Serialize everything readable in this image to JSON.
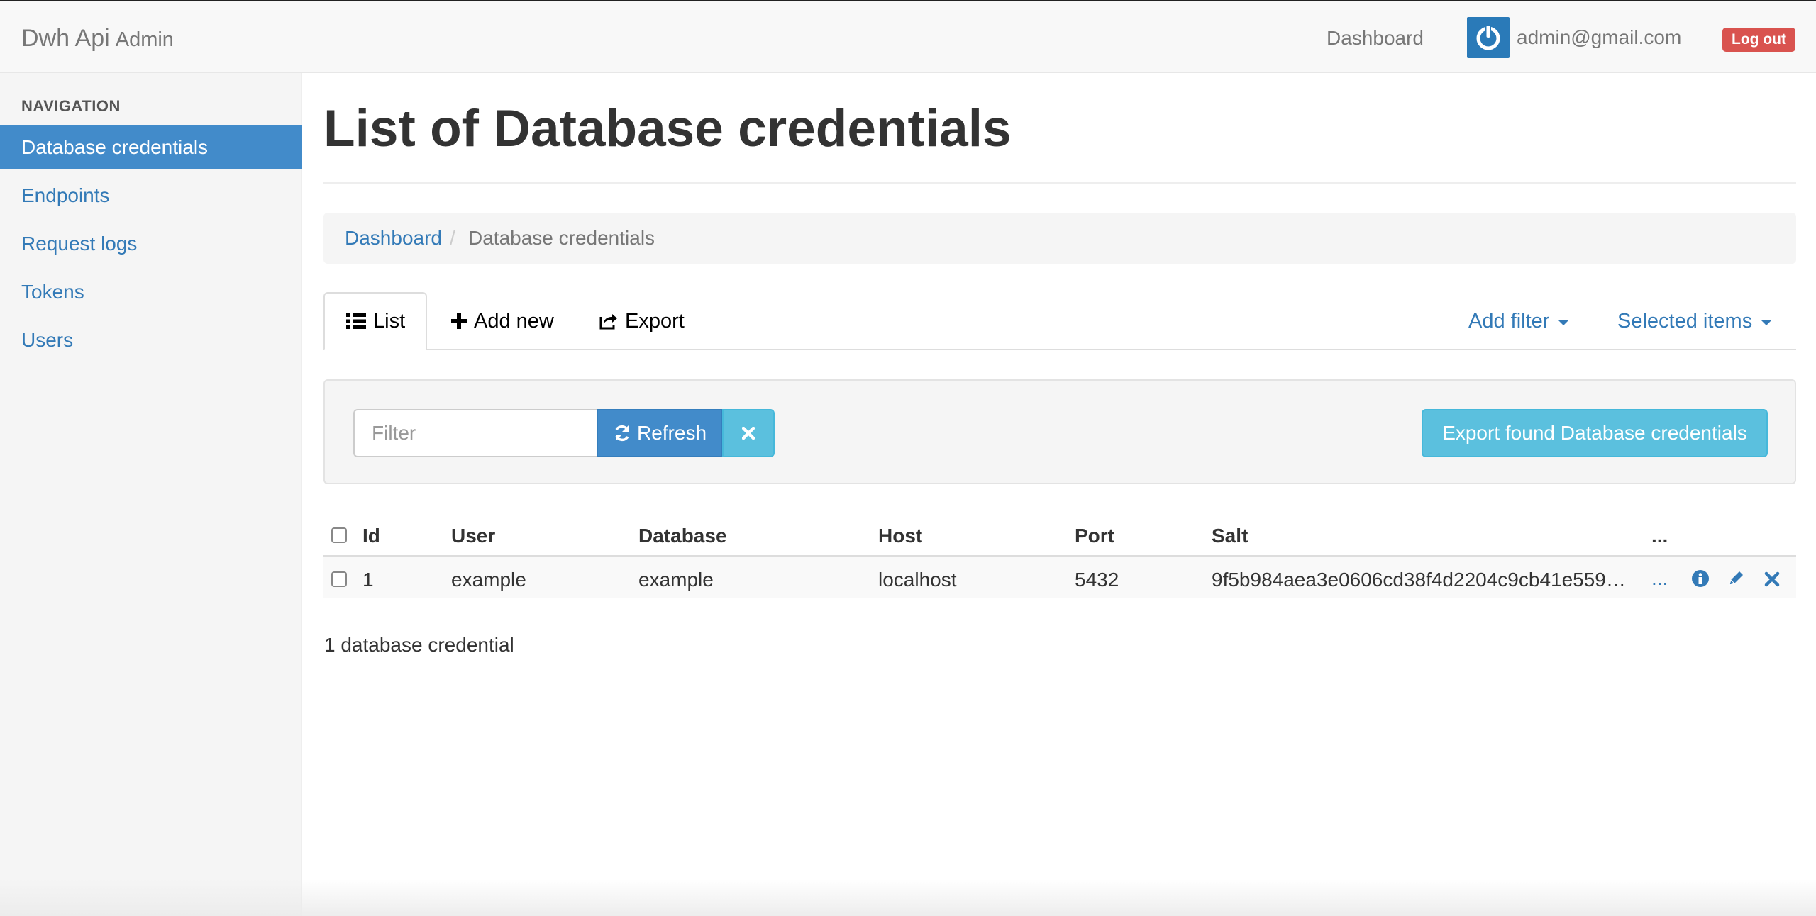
{
  "navbar": {
    "brand_main": "Dwh Api",
    "brand_sub": "Admin",
    "dashboard_link": "Dashboard",
    "user_email": "admin@gmail.com",
    "logout_label": "Log out",
    "avatar_icon": "power-icon",
    "avatar_color": "#2a7ab8"
  },
  "sidebar": {
    "header": "NAVIGATION",
    "items": [
      {
        "label": "Database credentials",
        "active": true
      },
      {
        "label": "Endpoints",
        "active": false
      },
      {
        "label": "Request logs",
        "active": false
      },
      {
        "label": "Tokens",
        "active": false
      },
      {
        "label": "Users",
        "active": false
      }
    ]
  },
  "page": {
    "title": "List of Database credentials"
  },
  "breadcrumb": {
    "link": "Dashboard",
    "separator": "/",
    "current": "Database credentials"
  },
  "tabs": {
    "list": "List",
    "add_new": "Add new",
    "export": "Export",
    "add_filter": "Add filter",
    "selected_items": "Selected items"
  },
  "filter": {
    "placeholder": "Filter",
    "refresh_label": "Refresh",
    "export_found_label": "Export found Database credentials"
  },
  "table": {
    "columns": [
      "Id",
      "User",
      "Database",
      "Host",
      "Port",
      "Salt",
      "..."
    ],
    "rows": [
      {
        "id": "1",
        "user": "example",
        "database": "example",
        "host": "localhost",
        "port": "5432",
        "salt": "9f5b984aea3e0606cd38f4d2204c9cb41e559…",
        "more": "..."
      }
    ],
    "row_actions": [
      "info-icon",
      "pencil-icon",
      "remove-icon"
    ]
  },
  "footer": {
    "count_text": "1 database credential"
  },
  "colors": {
    "primary": "#428bca",
    "link": "#337ab7",
    "info": "#5bc0de",
    "danger": "#d9534f"
  }
}
